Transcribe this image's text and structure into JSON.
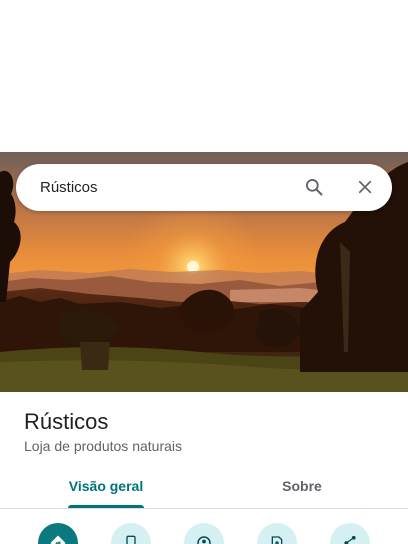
{
  "search": {
    "query": "Rústicos"
  },
  "place": {
    "name": "Rústicos",
    "category": "Loja de produtos naturais"
  },
  "tabs": [
    {
      "label": "Visão geral",
      "selected": true
    },
    {
      "label": "Sobre",
      "selected": false
    }
  ],
  "actions": [
    {
      "icon": "directions-icon"
    },
    {
      "icon": "phone-icon"
    },
    {
      "icon": "location-icon"
    },
    {
      "icon": "save-icon"
    },
    {
      "icon": "share-icon"
    }
  ],
  "colors": {
    "accent": "#00737a",
    "primary_action": "#0b7a80",
    "secondary_action": "#d4f0f2"
  }
}
